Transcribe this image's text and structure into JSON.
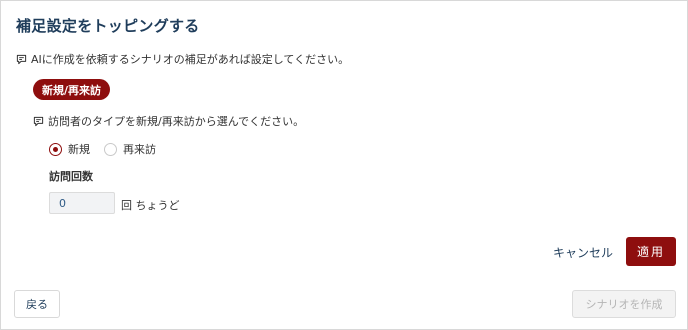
{
  "dialog": {
    "title": "補足設定をトッピングする",
    "hint": "AIに作成を依頼するシナリオの補足があれば設定してください。"
  },
  "topping": {
    "pill_label": "新規/再来訪",
    "hint": "訪問者のタイプを新規/再来訪から選んでください。",
    "options": [
      {
        "label": "新規",
        "selected": true
      },
      {
        "label": "再来訪",
        "selected": false
      }
    ],
    "visit_count_label": "訪問回数",
    "visit_count_value": "0",
    "visit_count_unit": "回 ちょうど"
  },
  "actions": {
    "cancel_label": "キャンセル",
    "apply_label": "適用"
  },
  "footer": {
    "back_label": "戻る",
    "create_label": "シナリオを作成"
  },
  "colors": {
    "accent": "#8e0e0e",
    "title": "#1f3d5b",
    "disabled_text": "#b5b5b5"
  },
  "icons": {
    "hint_icon": "message-edit-icon"
  }
}
